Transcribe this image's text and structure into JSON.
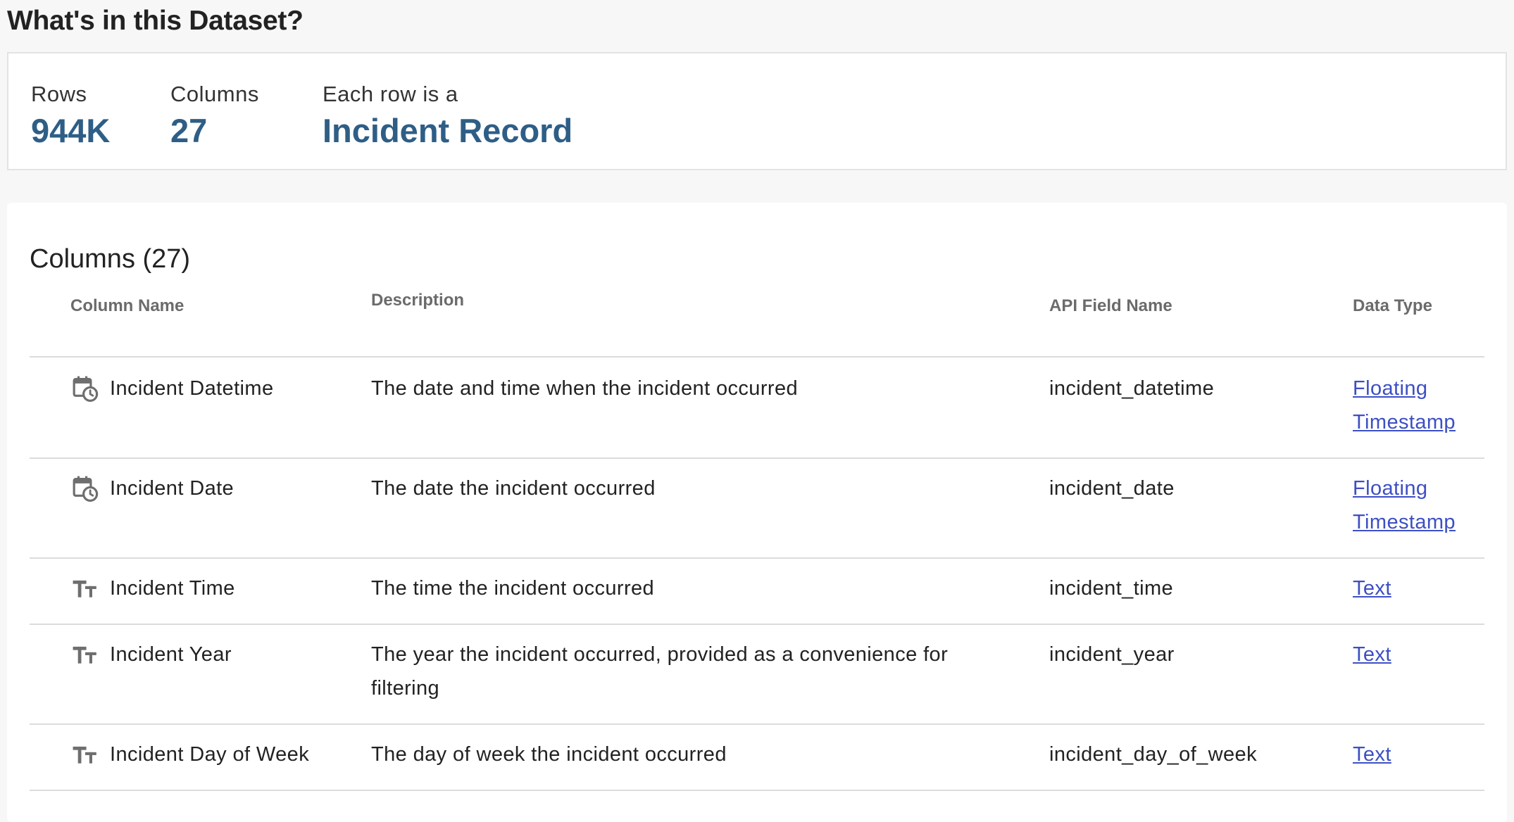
{
  "page": {
    "title": "What's in this Dataset?"
  },
  "summary": {
    "rows_label": "Rows",
    "rows_value": "944K",
    "columns_label": "Columns",
    "columns_value": "27",
    "each_row_label": "Each row is a",
    "each_row_value": "Incident Record"
  },
  "columns_section": {
    "heading": "Columns (27)",
    "headers": {
      "column_name": "Column Name",
      "description": "Description",
      "api_field_name": "API Field Name",
      "data_type": "Data Type"
    },
    "rows": [
      {
        "icon": "calendar-clock-icon",
        "name": "Incident Datetime",
        "description": "The date and time when the incident occurred",
        "api_field": "incident_datetime",
        "data_type": "Floating Timestamp"
      },
      {
        "icon": "calendar-clock-icon",
        "name": "Incident Date",
        "description": "The date the incident occurred",
        "api_field": "incident_date",
        "data_type": "Floating Timestamp"
      },
      {
        "icon": "text-type-icon",
        "name": "Incident Time",
        "description": "The time the incident occurred",
        "api_field": "incident_time",
        "data_type": "Text"
      },
      {
        "icon": "text-type-icon",
        "name": "Incident Year",
        "description": "The year the incident occurred, provided as a convenience for filtering",
        "api_field": "incident_year",
        "data_type": "Text"
      },
      {
        "icon": "text-type-icon",
        "name": "Incident Day of Week",
        "description": "The day of week the incident occurred",
        "api_field": "incident_day_of_week",
        "data_type": "Text"
      }
    ]
  },
  "colors": {
    "accent": "#2e5e86",
    "link": "#3d4fc4",
    "icon": "#6e6e6e",
    "header_text": "#6b6b6b",
    "divider": "#dcdcdc",
    "page_background": "#f7f7f7"
  }
}
